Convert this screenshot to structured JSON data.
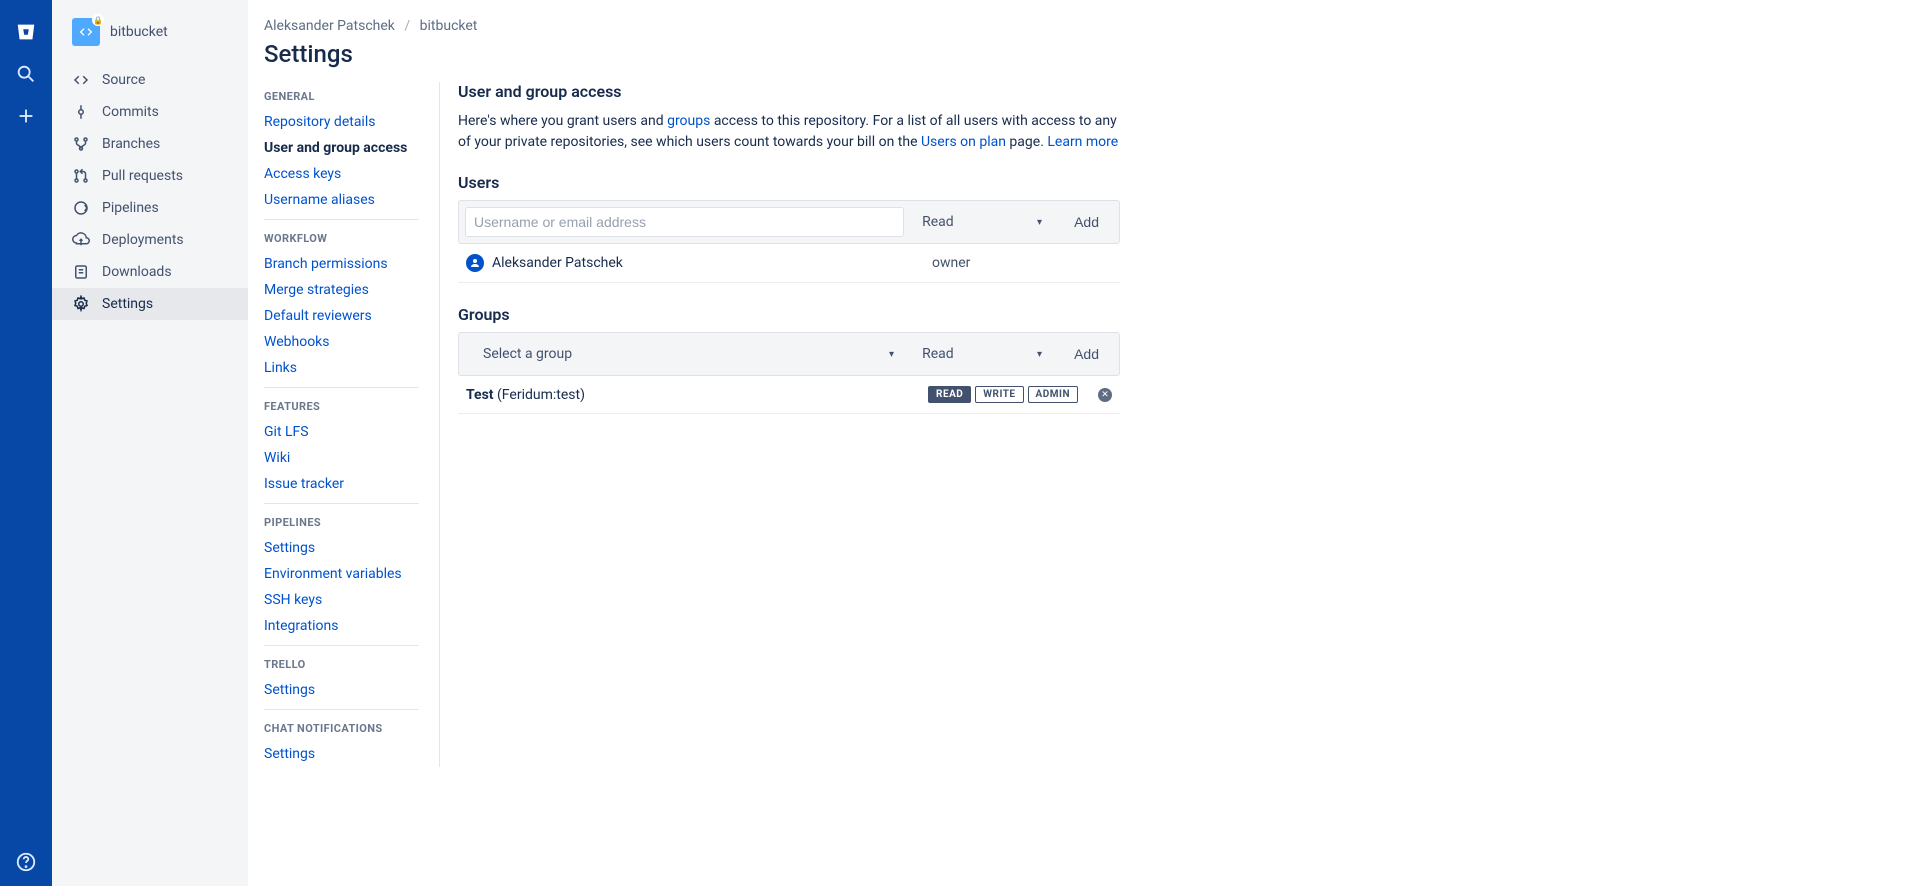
{
  "breadcrumb": {
    "owner": "Aleksander Patschek",
    "repo": "bitbucket"
  },
  "page_title": "Settings",
  "repo": {
    "name": "bitbucket"
  },
  "nav_items": [
    {
      "label": "Source"
    },
    {
      "label": "Commits"
    },
    {
      "label": "Branches"
    },
    {
      "label": "Pull requests"
    },
    {
      "label": "Pipelines"
    },
    {
      "label": "Deployments"
    },
    {
      "label": "Downloads"
    },
    {
      "label": "Settings"
    }
  ],
  "settings_nav": {
    "general": {
      "head": "GENERAL",
      "items": [
        "Repository details",
        "User and group access",
        "Access keys",
        "Username aliases"
      ]
    },
    "workflow": {
      "head": "WORKFLOW",
      "items": [
        "Branch permissions",
        "Merge strategies",
        "Default reviewers",
        "Webhooks",
        "Links"
      ]
    },
    "features": {
      "head": "FEATURES",
      "items": [
        "Git LFS",
        "Wiki",
        "Issue tracker"
      ]
    },
    "pipelines": {
      "head": "PIPELINES",
      "items": [
        "Settings",
        "Environment variables",
        "SSH keys",
        "Integrations"
      ]
    },
    "trello": {
      "head": "TRELLO",
      "items": [
        "Settings"
      ]
    },
    "chat": {
      "head": "CHAT NOTIFICATIONS",
      "items": [
        "Settings"
      ]
    }
  },
  "content": {
    "heading": "User and group access",
    "intro_1": "Here's where you grant users and ",
    "intro_link_groups": "groups",
    "intro_2": " access to this repository. For a list of all users with access to any of your private repositories, see which users count towards your bill on the ",
    "intro_link_plan": "Users on plan",
    "intro_3": " page. ",
    "intro_link_learn": "Learn more",
    "users_heading": "Users",
    "users_placeholder": "Username or email address",
    "perm_default": "Read",
    "add_label": "Add",
    "user_row": {
      "name": "Aleksander Patschek",
      "role": "owner"
    },
    "groups_heading": "Groups",
    "group_select_placeholder": "Select a group",
    "group_row": {
      "name": "Test",
      "suffix": " (Feridum:test)"
    },
    "perm_read": "READ",
    "perm_write": "WRITE",
    "perm_admin": "ADMIN"
  }
}
